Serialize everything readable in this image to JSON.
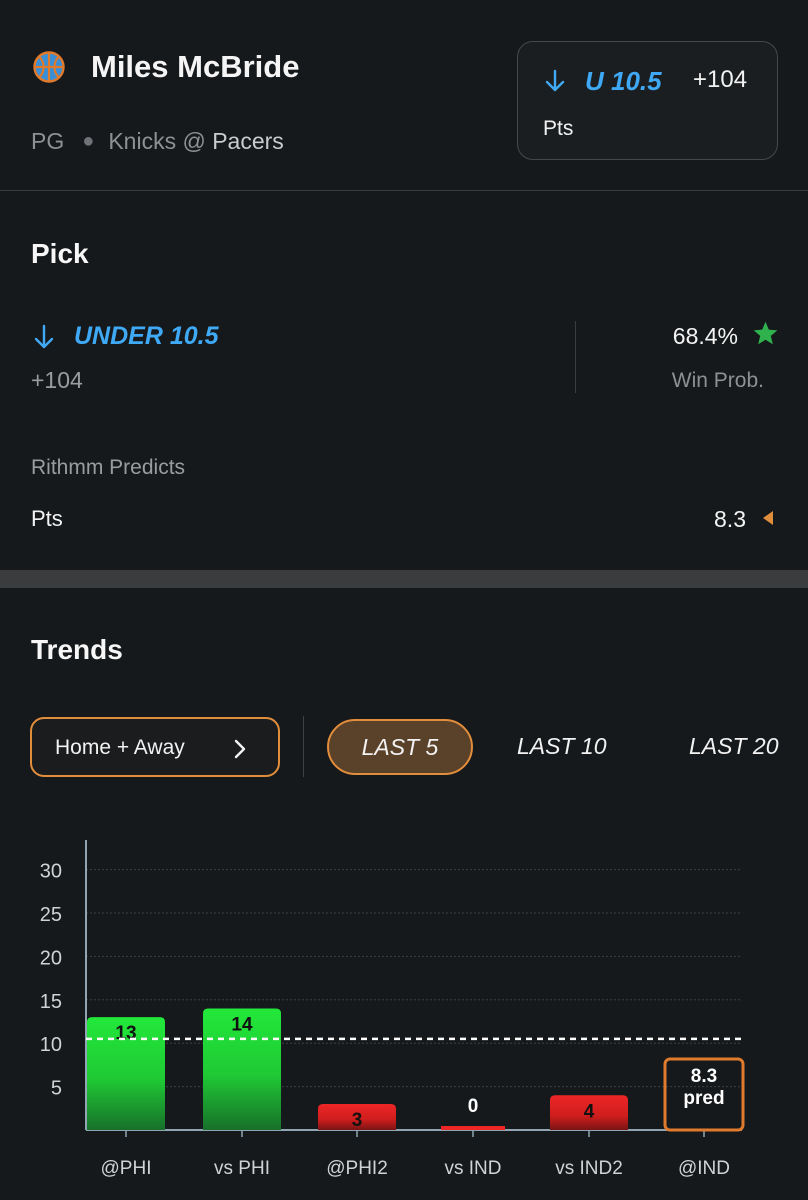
{
  "player": {
    "name": "Miles McBride",
    "position": "PG",
    "away_team": "Knicks",
    "at_symbol": "@",
    "home_team": "Pacers",
    "icon": "basketball-icon"
  },
  "bet_chip": {
    "direction_icon": "arrow-down-icon",
    "line": "U 10.5",
    "odds": "+104",
    "stat": "Pts"
  },
  "pick": {
    "title": "Pick",
    "line": "UNDER 10.5",
    "odds": "+104",
    "win_prob": "68.4%",
    "win_prob_label": "Win Prob.",
    "star_icon": "star-icon",
    "predicts_label": "Rithmm Predicts",
    "stat": "Pts",
    "predicted_value": "8.3",
    "indicator_icon": "triangle-left-icon"
  },
  "trends": {
    "title": "Trends",
    "filter_label": "Home + Away",
    "ranges": [
      "LAST 5",
      "LAST 10",
      "LAST 20"
    ],
    "active_range": "LAST 5"
  },
  "colors": {
    "accent_blue": "#3fa9f5",
    "accent_orange": "#e08d3c",
    "over_green": "#22e83a",
    "under_red": "#ee2626",
    "star_green": "#2fb24e"
  },
  "chart_data": {
    "type": "bar",
    "categories": [
      "@PHI",
      "vs PHI",
      "@PHI2",
      "vs IND",
      "vs IND2",
      "@IND"
    ],
    "values": [
      13,
      14,
      3,
      0,
      4,
      null
    ],
    "data_labels": [
      "13",
      "14",
      "3",
      "0",
      "4",
      ""
    ],
    "prediction": {
      "category": "@IND",
      "value": 8.3,
      "label": "8.3",
      "sublabel": "pred"
    },
    "line_value": 10.5,
    "ylim": [
      0,
      33
    ],
    "yticks": [
      5,
      10,
      15,
      20,
      25,
      30
    ],
    "grid": true
  }
}
